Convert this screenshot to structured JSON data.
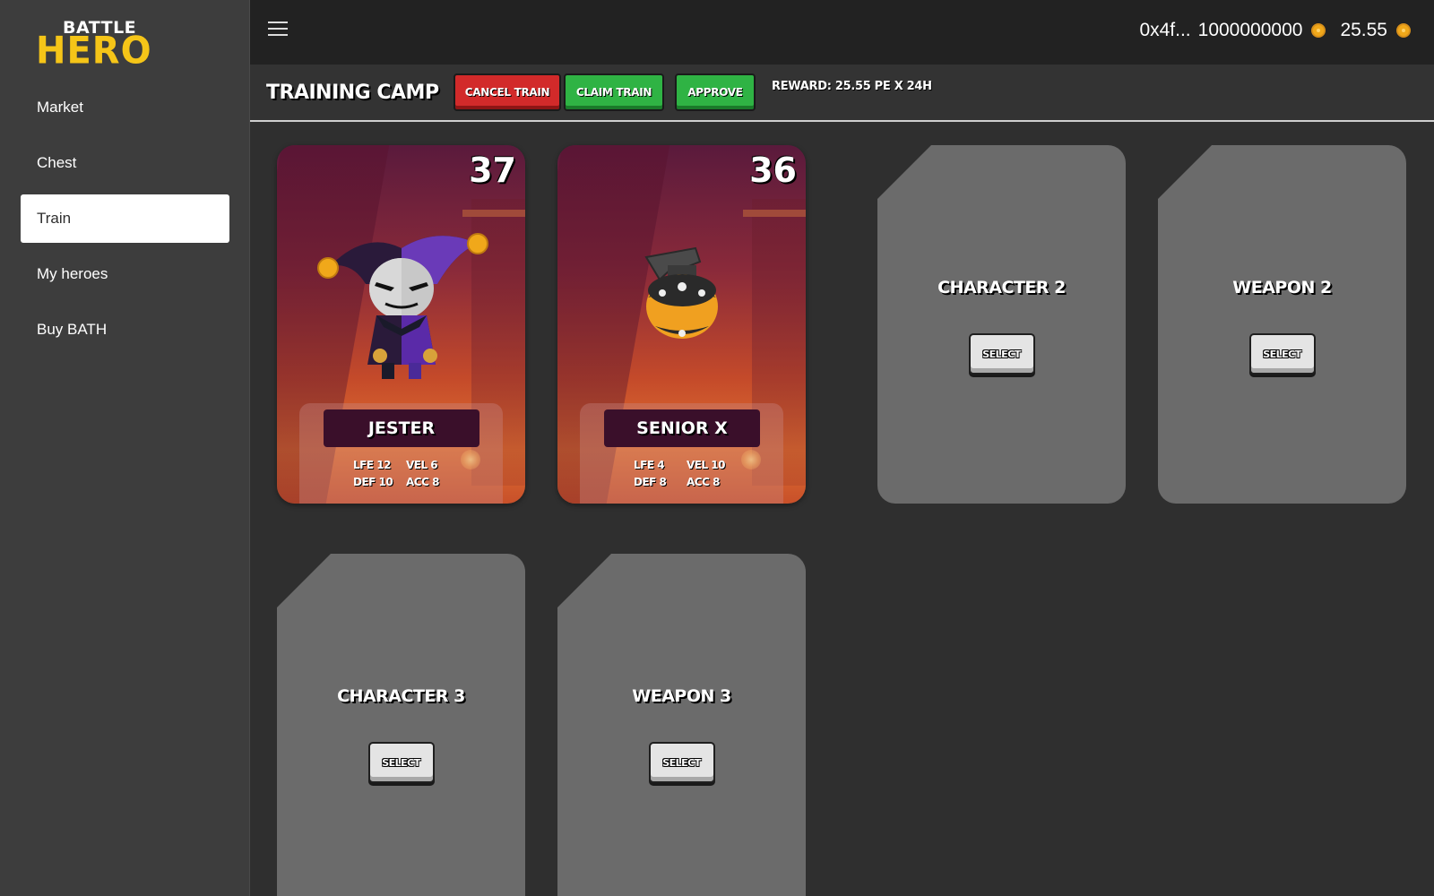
{
  "logo": {
    "top": "BATTLE",
    "bottom": "HERO"
  },
  "sidebar": {
    "items": [
      {
        "label": "Market",
        "active": false
      },
      {
        "label": "Chest",
        "active": false
      },
      {
        "label": "Train",
        "active": true
      },
      {
        "label": "My heroes",
        "active": false
      },
      {
        "label": "Buy BATH",
        "active": false
      }
    ]
  },
  "topbar": {
    "menu_icon": "hamburger-menu-icon",
    "wallet_address": "0x4f...",
    "balance_1": "1000000000",
    "balance_2": "25.55",
    "coin_icon": "coin-icon",
    "coin_color": "#f0a81a"
  },
  "training": {
    "title": "TRAINING CAMP",
    "cancel_label": "CANCEL TRAIN",
    "claim_label": "CLAIM TRAIN",
    "approve_label": "APPROVE",
    "reward": "REWARD: 25.55 PE X 24H",
    "cancel_color": "#d22a2a",
    "green_color": "#2fb344"
  },
  "cards": {
    "character1": {
      "level": "37",
      "name": "JESTER",
      "stats": [
        "LFE 12",
        "VEL 6",
        "DEF 10",
        "ACC 8"
      ],
      "art": "jester-character"
    },
    "weapon1": {
      "level": "36",
      "name": "SENIOR X",
      "stats": [
        "LFE 4",
        "VEL 10",
        "DEF 8",
        "ACC 8"
      ],
      "art": "grenade-weapon"
    },
    "character2": {
      "title": "CHARACTER 2",
      "select_label": "SELECT"
    },
    "weapon2": {
      "title": "WEAPON 2",
      "select_label": "SELECT"
    },
    "character3": {
      "title": "CHARACTER 3",
      "select_label": "SELECT"
    },
    "weapon3": {
      "title": "WEAPON 3",
      "select_label": "SELECT"
    }
  }
}
